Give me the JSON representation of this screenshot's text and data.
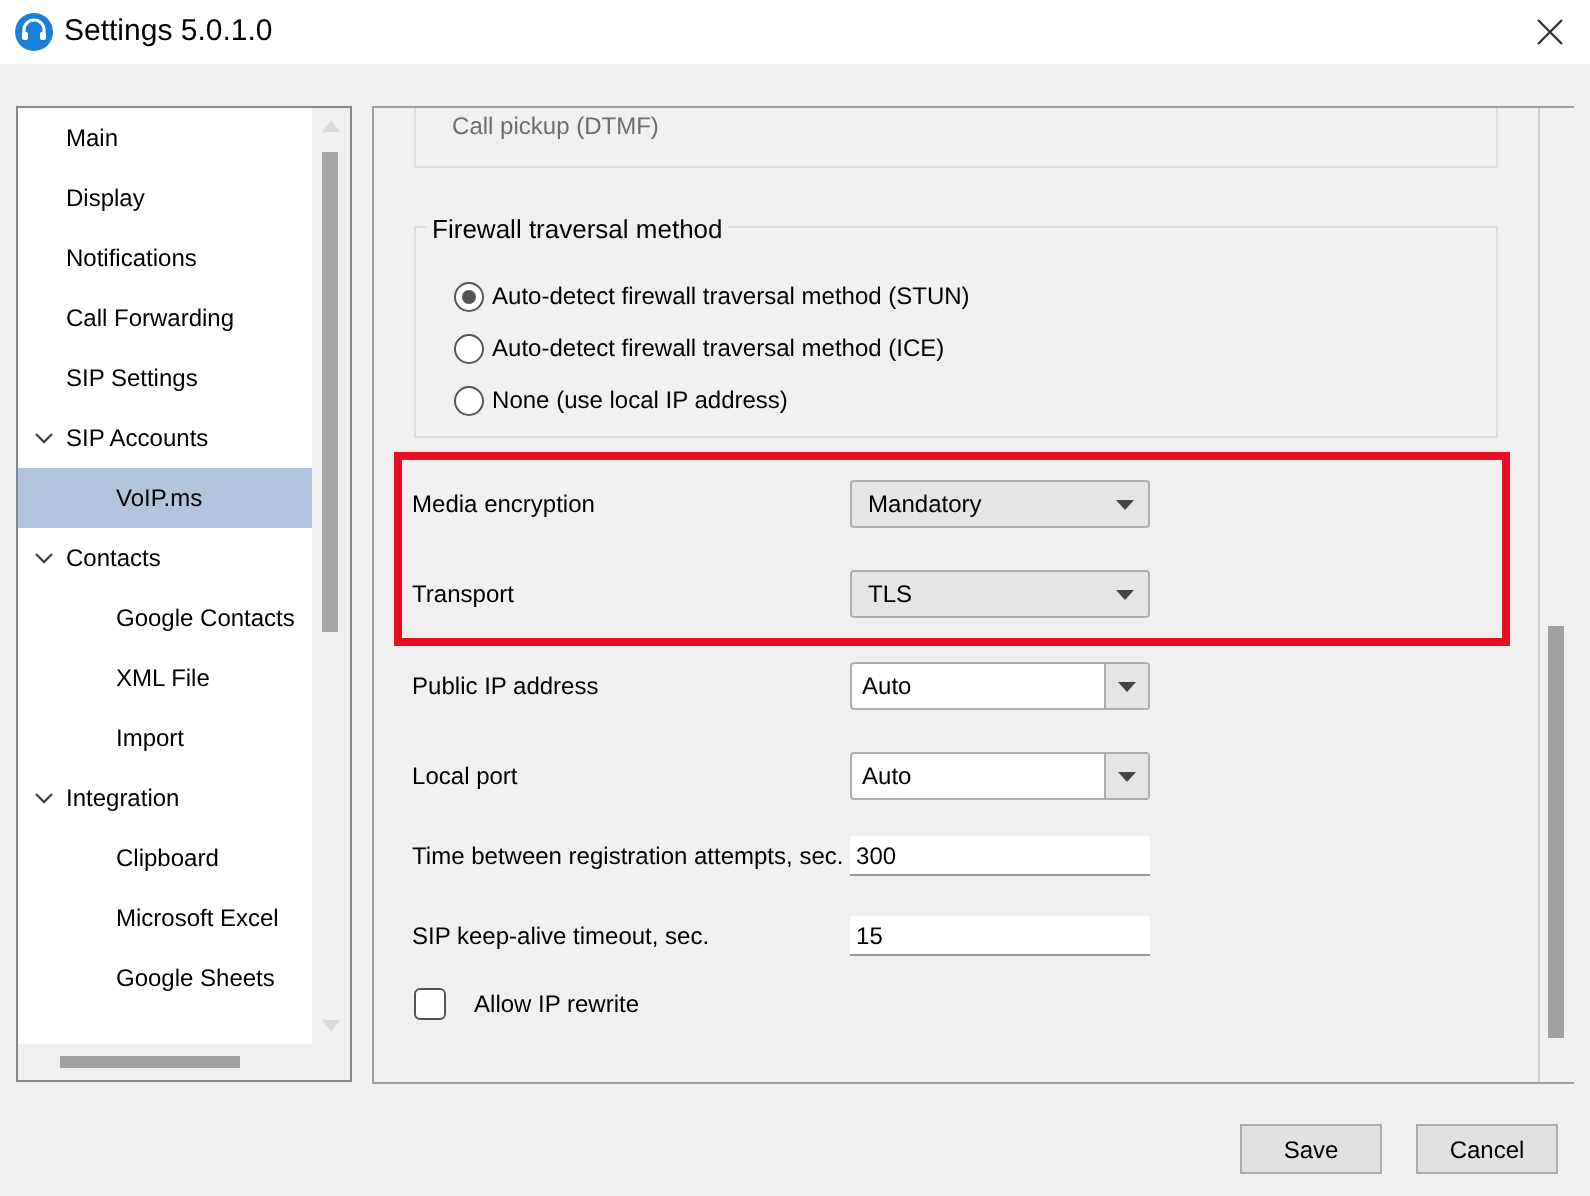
{
  "window": {
    "title": "Settings 5.0.1.0"
  },
  "sidebar": {
    "items": [
      {
        "label": "Main",
        "selected": false
      },
      {
        "label": "Display",
        "selected": false
      },
      {
        "label": "Notifications",
        "selected": false
      },
      {
        "label": "Call Forwarding",
        "selected": false
      },
      {
        "label": "SIP Settings",
        "selected": false
      },
      {
        "label": "SIP Accounts",
        "selected": false,
        "expanded": true,
        "children": [
          {
            "label": "VoIP.ms",
            "selected": true
          }
        ]
      },
      {
        "label": "Contacts",
        "selected": false,
        "expanded": true,
        "children": [
          {
            "label": "Google Contacts",
            "selected": false
          },
          {
            "label": "XML File",
            "selected": false
          },
          {
            "label": "Import",
            "selected": false
          }
        ]
      },
      {
        "label": "Integration",
        "selected": false,
        "expanded": true,
        "children": [
          {
            "label": "Clipboard",
            "selected": false
          },
          {
            "label": "Microsoft Excel",
            "selected": false
          },
          {
            "label": "Google Sheets",
            "selected": false
          }
        ]
      }
    ]
  },
  "previous_group": {
    "item": "Call pickup (DTMF)"
  },
  "firewall": {
    "title": "Firewall traversal method",
    "options": [
      {
        "label": "Auto-detect firewall traversal method (STUN)",
        "selected": true
      },
      {
        "label": "Auto-detect firewall traversal method (ICE)",
        "selected": false
      },
      {
        "label": "None (use local IP address)",
        "selected": false
      }
    ]
  },
  "highlighted_settings": [
    {
      "label": "Media encryption",
      "kind": "dropdown",
      "value": "Mandatory"
    },
    {
      "label": "Transport",
      "kind": "dropdown",
      "value": "TLS"
    }
  ],
  "settings": [
    {
      "label": "Public IP address",
      "kind": "combo",
      "value": "Auto"
    },
    {
      "label": "Local port",
      "kind": "combo",
      "value": "Auto"
    },
    {
      "label": "Time between registration attempts, sec.",
      "kind": "text",
      "value": "300"
    },
    {
      "label": "SIP keep-alive timeout, sec.",
      "kind": "text",
      "value": "15"
    }
  ],
  "allow_ip_rewrite": {
    "label": "Allow IP rewrite",
    "checked": false
  },
  "buttons": [
    "Save",
    "Cancel"
  ]
}
